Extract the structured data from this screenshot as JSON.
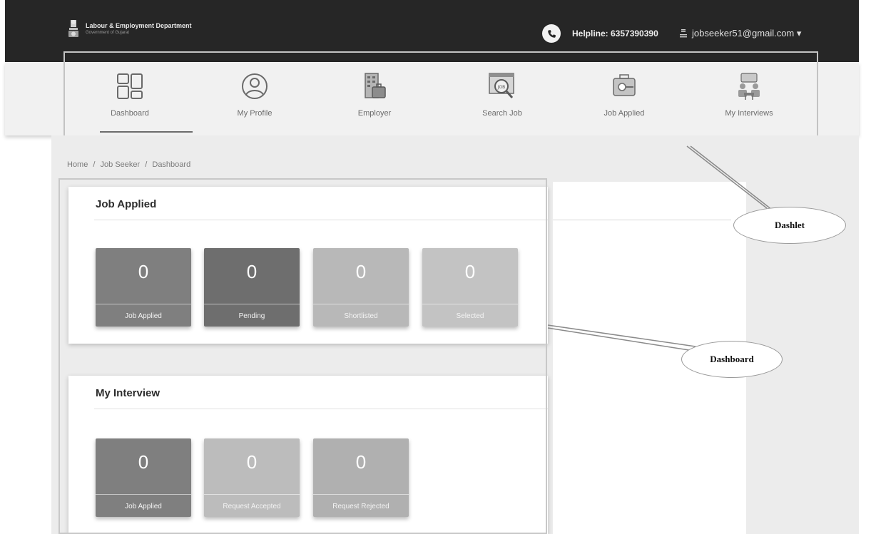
{
  "header": {
    "org_name": "Labour & Employment Department",
    "org_sub": "Government of Gujarat",
    "helpline": "Helpline: 6357390390",
    "user_email": "jobseeker51@gmail.com",
    "dropdown_caret": "▾",
    "icons": [
      "state-emblem-icon",
      "phone-icon",
      "user-icon",
      "caret-down-icon"
    ]
  },
  "nav": {
    "active": "Dashboard",
    "items": [
      {
        "label": "Dashboard",
        "icon": "dashboard-grid-icon"
      },
      {
        "label": "My Profile",
        "icon": "profile-icon"
      },
      {
        "label": "Employer",
        "icon": "employer-icon"
      },
      {
        "label": "Search Job",
        "icon": "search-job-icon"
      },
      {
        "label": "Job Applied",
        "icon": "job-applied-icon"
      },
      {
        "label": "My Interviews",
        "icon": "interviews-icon"
      }
    ]
  },
  "breadcrumb": [
    "Home",
    "/",
    "Job Seeker",
    "/",
    "Dashboard"
  ],
  "job_applied_card": {
    "title": "Job Applied",
    "tiles": [
      {
        "value": "0",
        "label": "Job Applied"
      },
      {
        "value": "0",
        "label": "Pending"
      },
      {
        "value": "0",
        "label": "Shortlisted"
      },
      {
        "value": "0",
        "label": "Selected"
      }
    ]
  },
  "interview_card": {
    "title": "My Interview",
    "tiles": [
      {
        "value": "0",
        "label": "Job Applied"
      },
      {
        "value": "0",
        "label": "Request Accepted"
      },
      {
        "value": "0",
        "label": "Request Rejected"
      }
    ]
  },
  "annotations": {
    "dashlet": "Dashlet",
    "dashboard": "Dashboard"
  },
  "colors": {
    "header_bg": "#262626",
    "tile_dark": "#7f7f7f",
    "tile_mid": "#6e6e6e",
    "tile_light": "#b8b8b8",
    "tile_lighter": "#c3c3c3"
  }
}
